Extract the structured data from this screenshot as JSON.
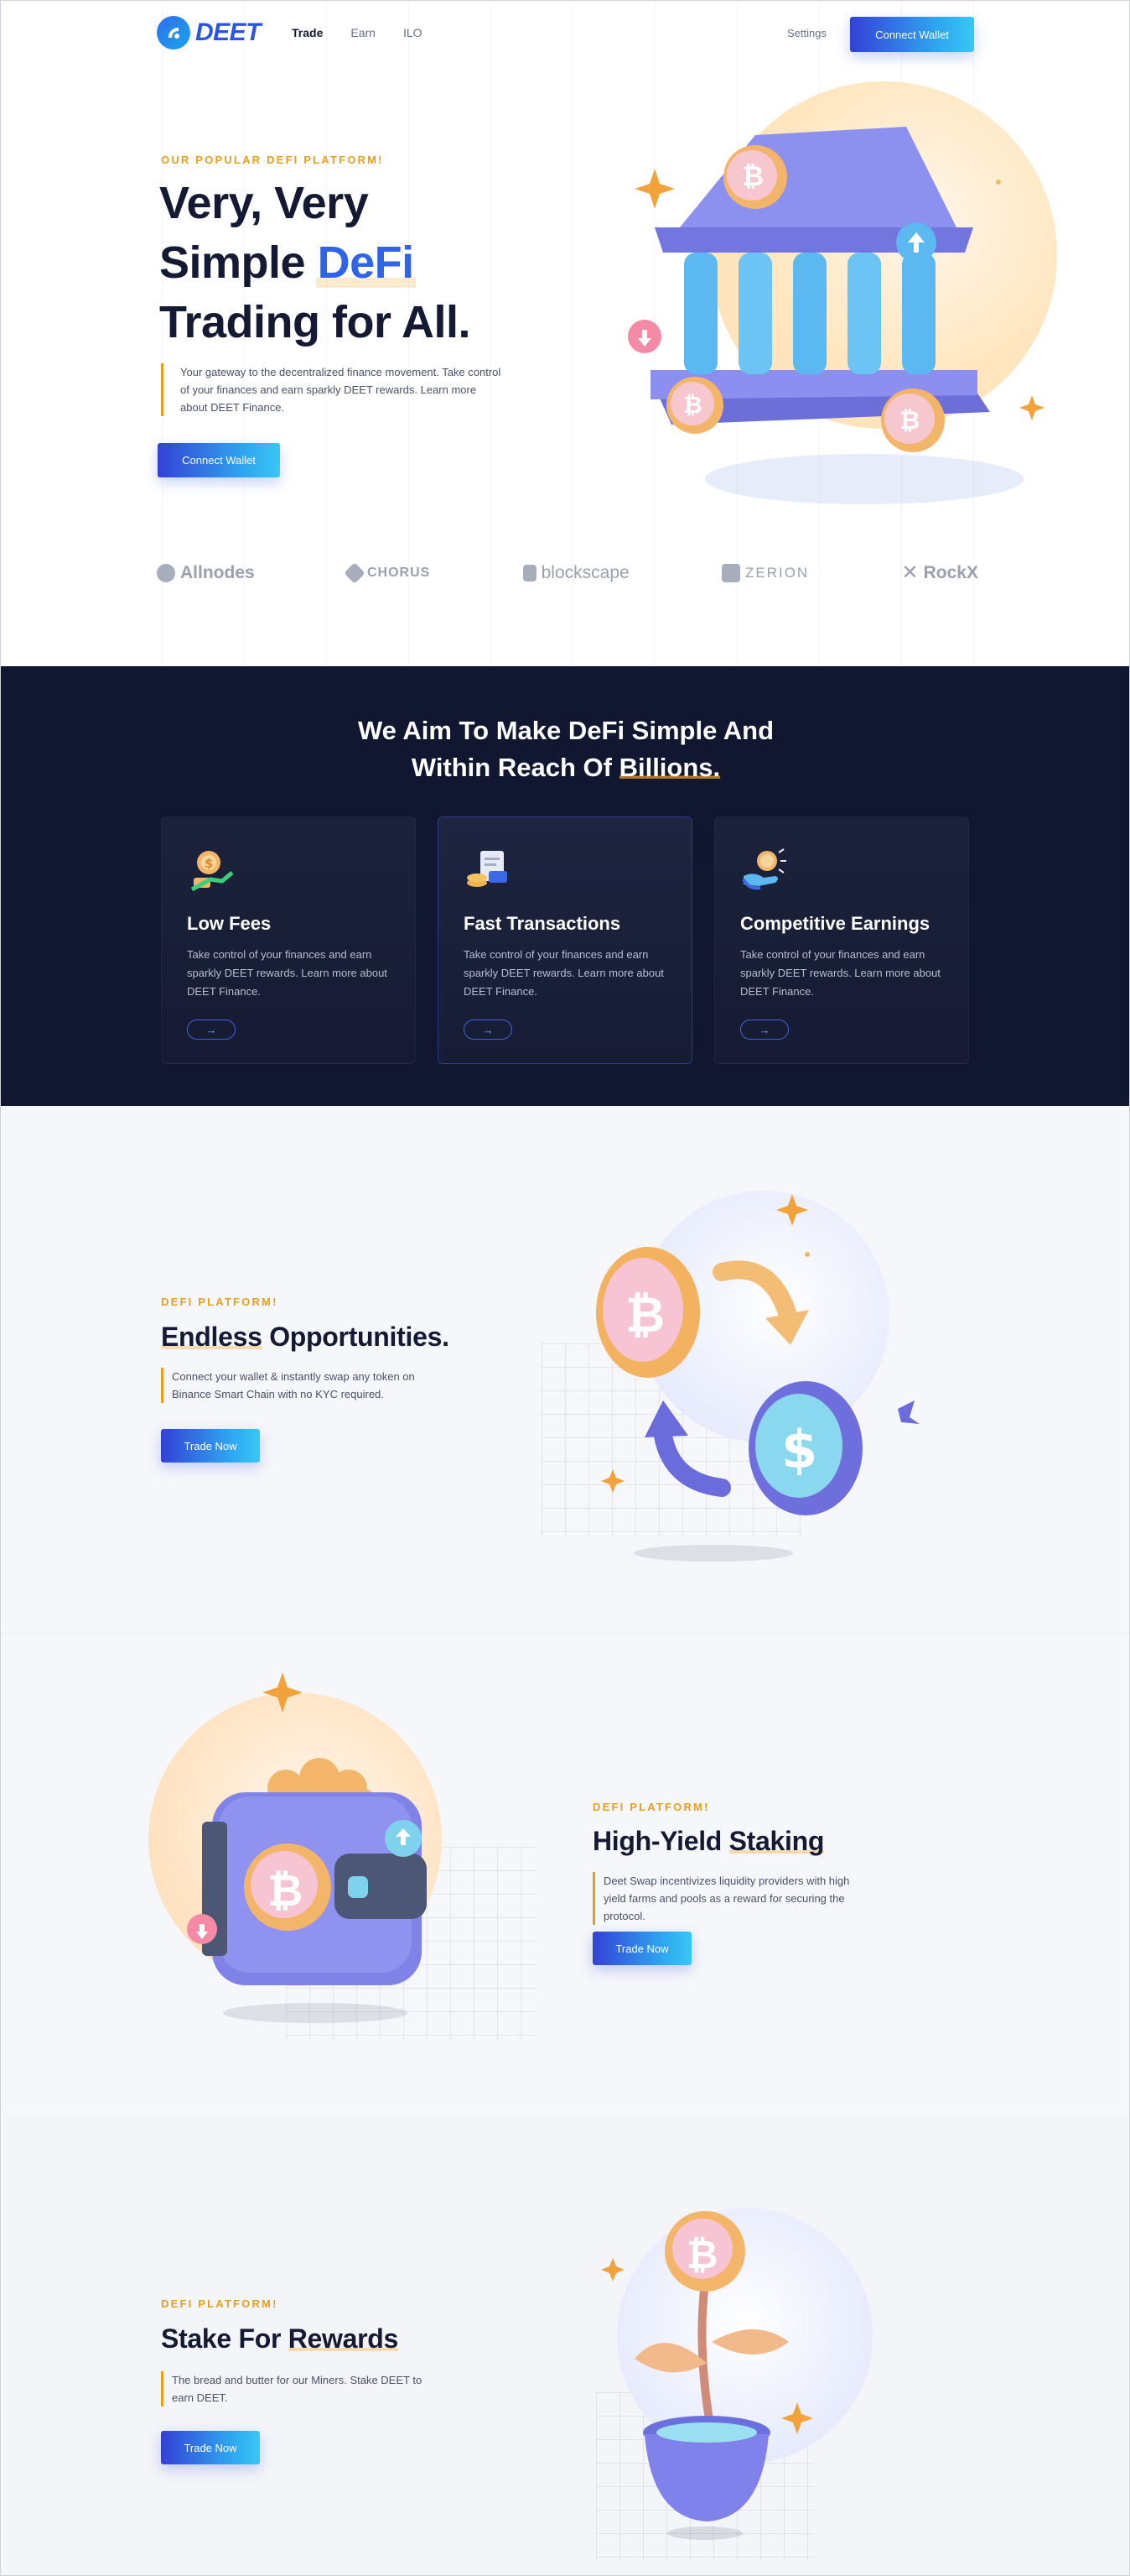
{
  "header": {
    "logo_text": "DEET",
    "nav": [
      "Trade",
      "Earn",
      "ILO"
    ],
    "settings": "Settings",
    "connect_wallet": "Connect Wallet"
  },
  "hero": {
    "eyebrow": "OUR POPULAR DEFI PLATFORM!",
    "title_line1": "Very, Very",
    "title_line2_prefix": "Simple",
    "title_highlight": "DeFi",
    "title_line3": "Trading for All.",
    "description": "Your gateway to the decentralized finance movement. Take control of your finances and earn sparkly DEET rewards. Learn more about DEET Finance.",
    "cta": "Connect Wallet"
  },
  "partners": [
    "Allnodes",
    "CHORUS",
    "blockscape",
    "ZERION",
    "RockX"
  ],
  "mission": {
    "title_line1": "We Aim To Make DeFi Simple And",
    "title_line2_prefix": "Within Reach Of",
    "title_line2_highlight": "Billions."
  },
  "features": [
    {
      "title": "Low Fees",
      "desc": "Take control of your finances and earn sparkly DEET rewards. Learn more about DEET Finance.",
      "arrow": "→"
    },
    {
      "title": "Fast Transactions",
      "desc": "Take control of your finances and earn sparkly DEET rewards. Learn more about DEET Finance.",
      "arrow": "→"
    },
    {
      "title": "Competitive Earnings",
      "desc": "Take control of your finances and earn sparkly DEET rewards. Learn more about DEET Finance.",
      "arrow": "→"
    }
  ],
  "sections": [
    {
      "eyebrow": "DEFI PLATFORM!",
      "title_u": "Endless",
      "title_rest": " Opportunities.",
      "desc": "Connect your wallet & instantly swap any token on Binance Smart Chain with no KYC required.",
      "cta": "Trade Now"
    },
    {
      "eyebrow": "DEFI PLATFORM!",
      "title_pre": "High-Yield ",
      "title_u": "Staking",
      "desc": "Deet Swap incentivizes liquidity providers with high yield farms and pools as a reward for securing the protocol.",
      "cta": "Trade Now"
    },
    {
      "eyebrow": "DEFI PLATFORM!",
      "title_pre": "Stake For ",
      "title_u": "Rewards",
      "desc": "The bread and butter for our Miners. Stake DEET to earn DEET.",
      "cta": "Trade Now"
    }
  ],
  "colors": {
    "accent": "#2f63e8",
    "gold": "#e5a11c",
    "dark": "#111631"
  }
}
